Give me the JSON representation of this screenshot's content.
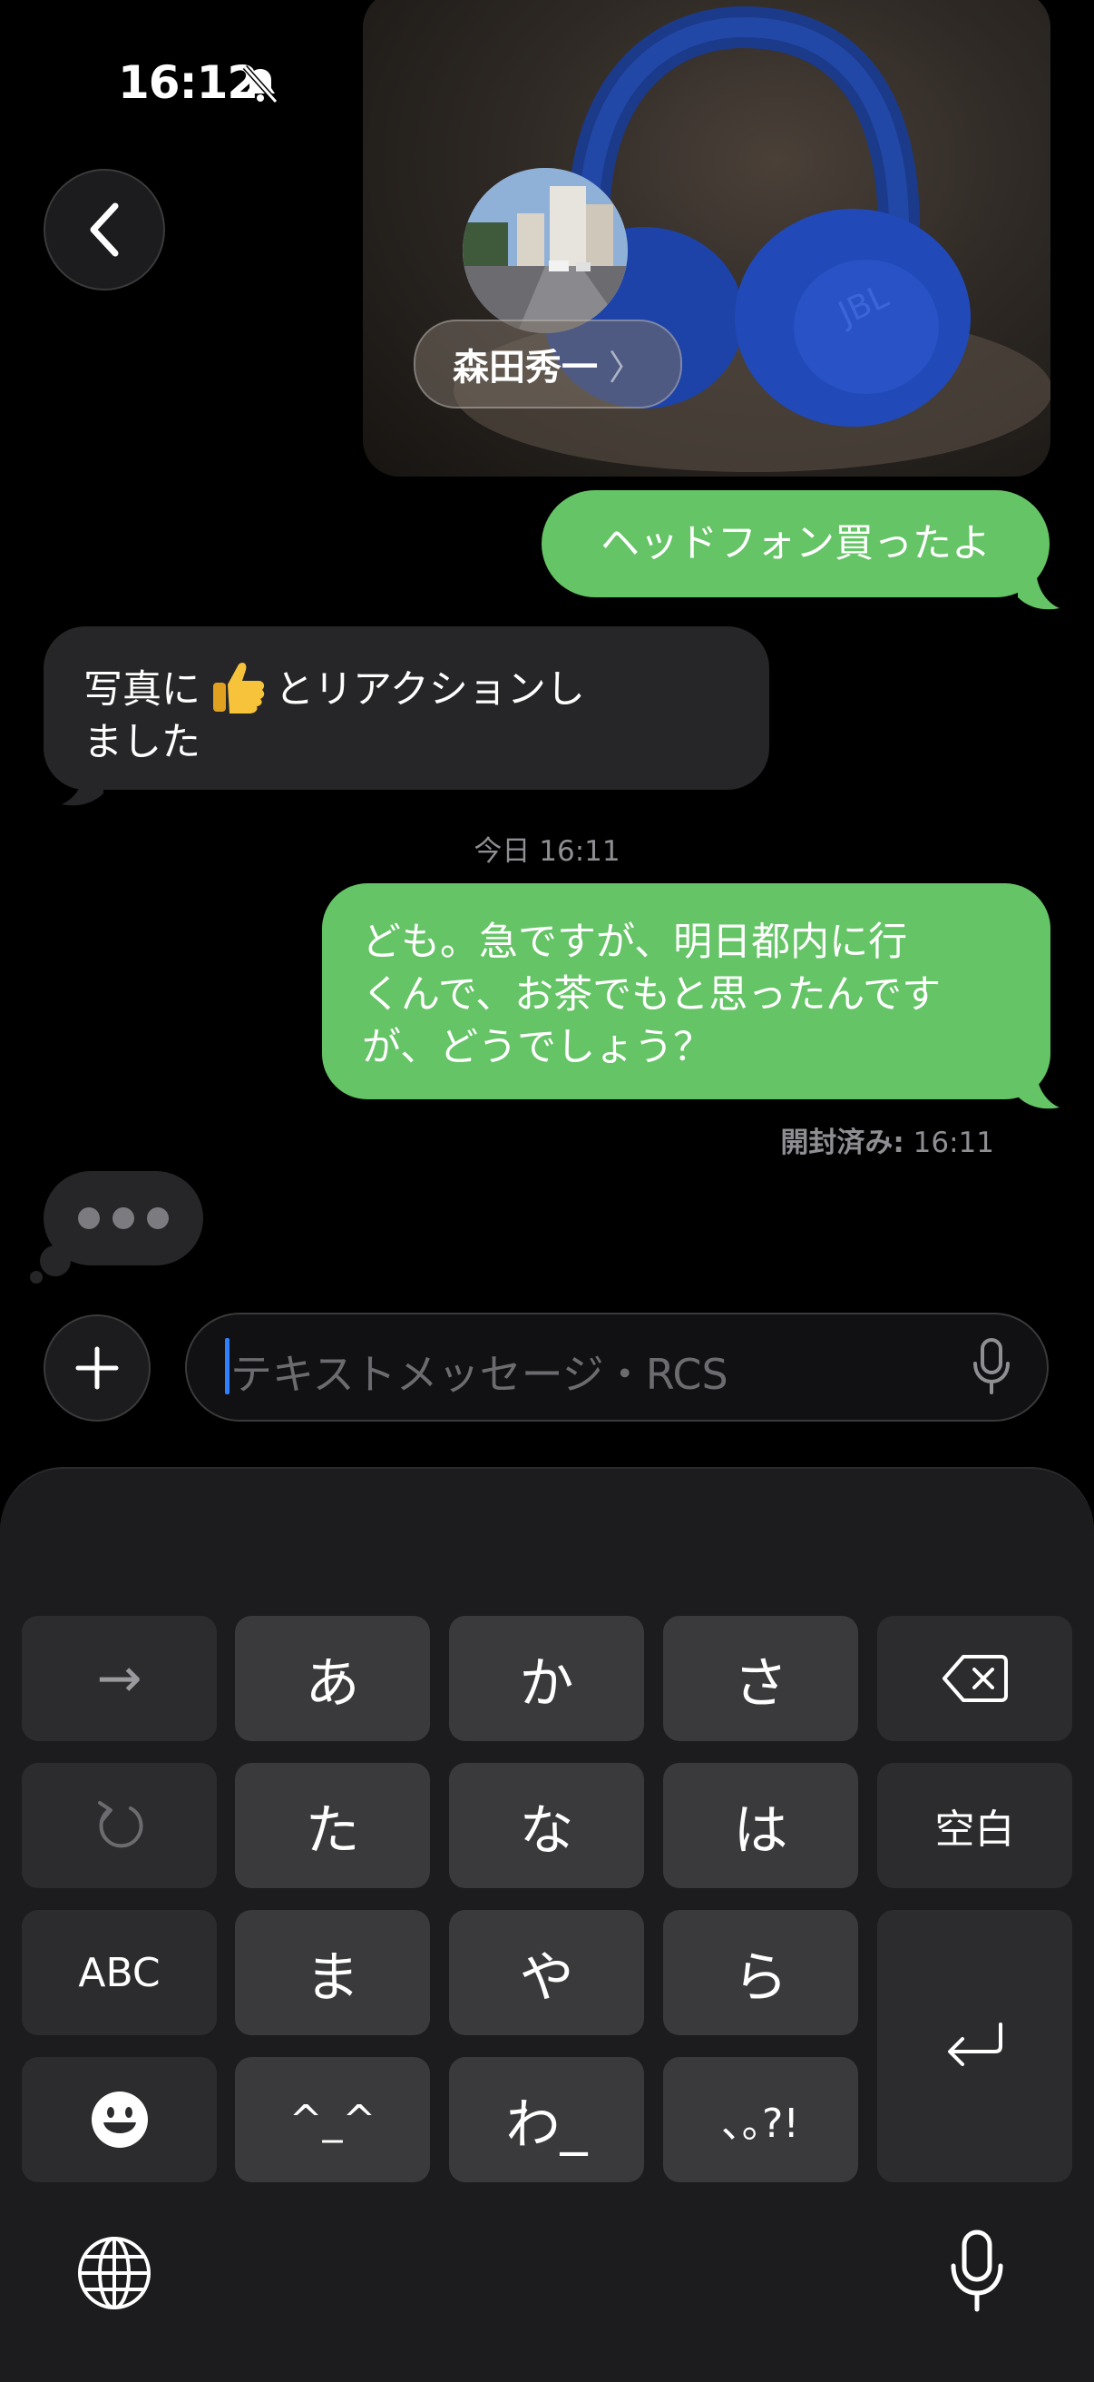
{
  "status_bar": {
    "time": "16:12"
  },
  "header": {
    "contact_name": "森田秀一",
    "contact_chevron": "〉"
  },
  "messages": {
    "outgoing_1": "ヘッドフォン買ったよ",
    "incoming_reaction_pre": "写真に",
    "incoming_reaction_post": "とリアクションし",
    "incoming_reaction_line2": "ました",
    "timestamp_day": "今日 16:11",
    "outgoing_2_line1": "ども。急ですが、明日都内に行",
    "outgoing_2_line2": "くんで、お茶でもと思ったんです",
    "outgoing_2_line3": "が、どうでしょう？",
    "read_label": "開封済み:",
    "read_time": "16:11"
  },
  "composer": {
    "placeholder": "テキストメッセージ・RCS"
  },
  "keyboard": {
    "row1": [
      "→",
      "あ",
      "か",
      "さ"
    ],
    "row2": [
      "た",
      "な",
      "は",
      "空白"
    ],
    "row3": [
      "ABC",
      "ま",
      "や",
      "ら"
    ],
    "row4": [
      "^_^",
      "わ_",
      "､｡?!"
    ]
  },
  "icons": {
    "bell": "bell-slash-icon",
    "signal": "cellular-signal-icon",
    "wifi": "wifi-icon",
    "battery": "battery-icon",
    "back": "chevron-left-icon",
    "plus": "plus-icon",
    "mic": "microphone-icon",
    "thumbs_up": "thumbs-up-icon",
    "delete": "delete-backward-icon",
    "undo": "undo-icon",
    "emoji": "emoji-face-icon",
    "return": "return-icon",
    "globe": "globe-icon"
  },
  "colors": {
    "outgoing_bubble": "#65c466",
    "incoming_bubble": "#262628",
    "caret": "#2f80ff"
  }
}
